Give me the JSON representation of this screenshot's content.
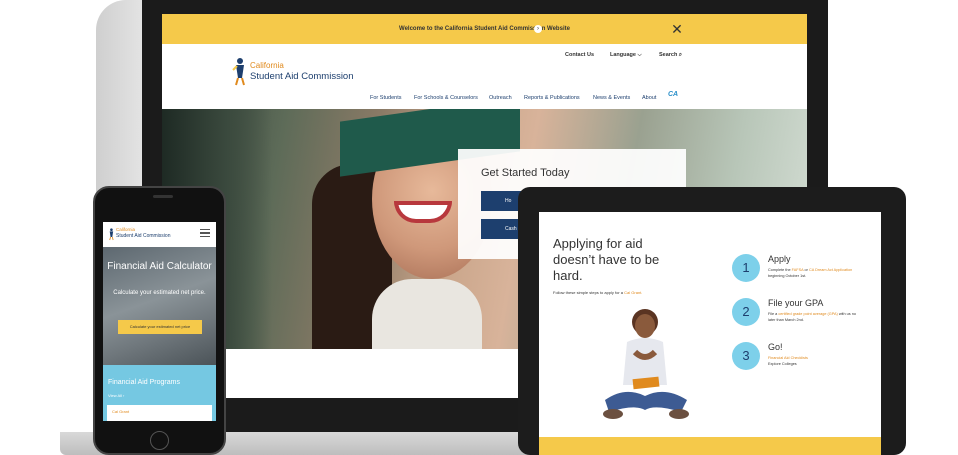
{
  "laptop": {
    "banner": {
      "text": "Welcome to the California Student Aid Commission Website",
      "arrow": "›",
      "close": "✕"
    },
    "utility_nav": {
      "contact": "Contact Us",
      "language": "Language ⌵",
      "search": "Search ⌕"
    },
    "logo": {
      "line1": "California",
      "line2": "Student Aid Commission"
    },
    "main_nav": [
      "For Students",
      "For Schools & Counselors",
      "Outreach",
      "Reports & Publications",
      "News & Events",
      "About"
    ],
    "nav_badge": "CA",
    "hero_card": {
      "title": "Get Started Today",
      "button1": "Ho",
      "button2": "Cash"
    }
  },
  "phone": {
    "logo": {
      "line1": "California",
      "line2": "Student Aid Commission"
    },
    "hero": {
      "title": "Financial Aid Calculator",
      "subtitle": "Calculate your estimated net price.",
      "button": "Calculate your estimated net price"
    },
    "programs": {
      "title": "Financial Aid Programs",
      "view_all": "View All ›",
      "first_item": "Cal Grant"
    }
  },
  "tablet": {
    "heading": "Applying for aid doesn’t have to be hard.",
    "subtext_prefix": "Follow these simple steps to apply for a ",
    "subtext_highlight": "Cal Grant.",
    "steps": [
      {
        "number": "1",
        "title": "Apply",
        "desc_parts": [
          "Complete the ",
          "FAFSA",
          " or ",
          "CA Dream Act Application",
          " beginning October 1st."
        ]
      },
      {
        "number": "2",
        "title": "File your GPA",
        "desc_parts": [
          "File a ",
          "certified grade point average (GPA)",
          " with us no later than March 2nd."
        ]
      },
      {
        "number": "3",
        "title": "Go!",
        "desc_parts": [
          "Financial Aid Checklists",
          "Explore Colleges"
        ]
      }
    ]
  },
  "colors": {
    "yellow": "#f5c94a",
    "navy": "#1d3f6e",
    "orange": "#e08a1e",
    "light_blue": "#7dd0ea"
  }
}
